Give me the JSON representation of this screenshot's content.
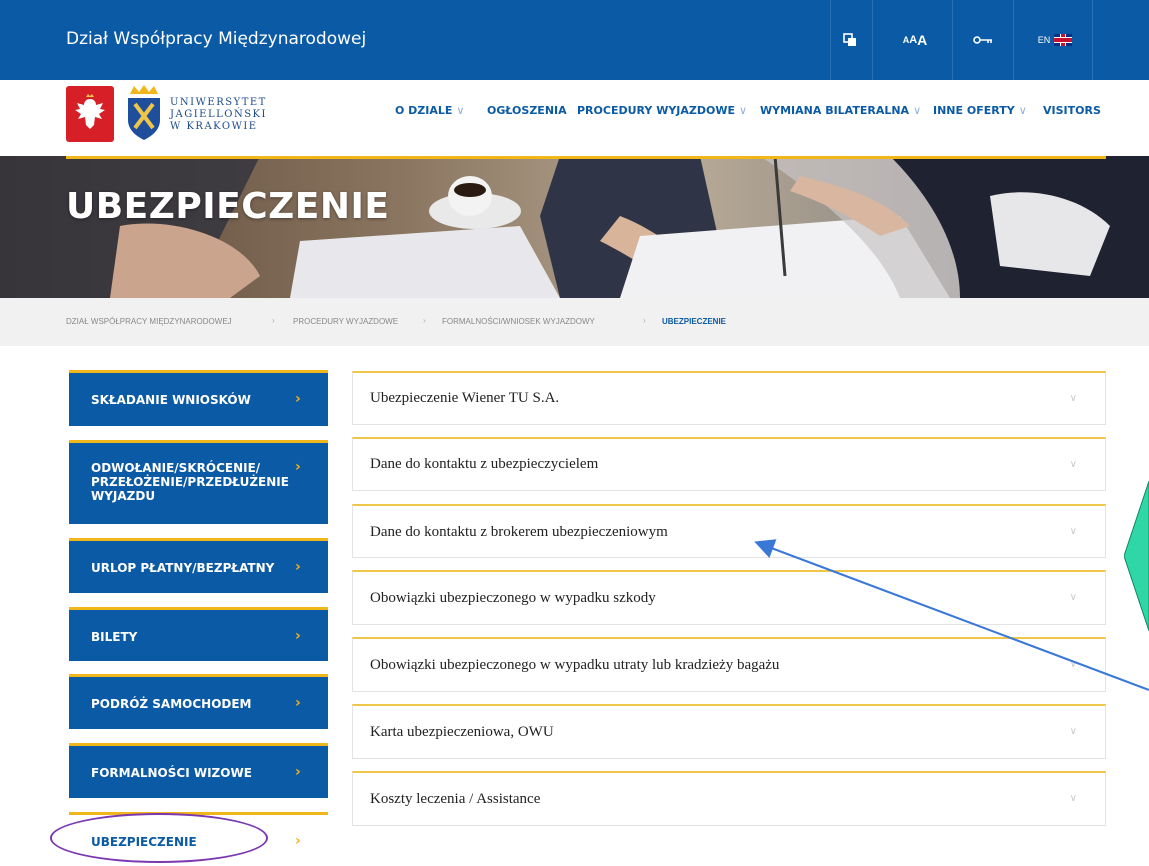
{
  "top_bar": {
    "title": "Dział Współpracy Międzynarodowej",
    "font_size_labels": [
      "A",
      "A",
      "A"
    ],
    "language": "EN"
  },
  "logo": {
    "line1": "UNIWERSYTET",
    "line2": "JAGIELLOŃSKI",
    "line3": "W KRAKOWIE"
  },
  "nav": {
    "items": [
      {
        "label": "O DZIALE",
        "has_dropdown": true
      },
      {
        "label": "OGŁOSZENIA",
        "has_dropdown": false
      },
      {
        "label": "PROCEDURY WYJAZDOWE",
        "has_dropdown": true
      },
      {
        "label": "WYMIANA BILATERALNA",
        "has_dropdown": true
      },
      {
        "label": "INNE OFERTY",
        "has_dropdown": true
      },
      {
        "label": "VISITORS",
        "has_dropdown": false
      }
    ]
  },
  "hero": {
    "title": "UBEZPIECZENIE"
  },
  "breadcrumb": {
    "items": [
      "DZIAŁ WSPÓŁPRACY MIĘDZYNARODOWEJ",
      "PROCEDURY WYJAZDOWE",
      "FORMALNOŚCI/WNIOSEK WYJAZDOWY",
      "UBEZPIECZENIE"
    ],
    "separator": "›"
  },
  "sidebar": {
    "items": [
      {
        "label": "SKŁADANIE WNIOSKÓW",
        "active": false
      },
      {
        "label": "ODWOŁANIE/SKRÓCENIE/ PRZEŁOŻENIE/PRZEDŁUŻENIE WYJAZDU",
        "active": false
      },
      {
        "label": "URLOP PŁATNY/BEZPŁATNY",
        "active": false
      },
      {
        "label": "BILETY",
        "active": false
      },
      {
        "label": "PODRÓŻ SAMOCHODEM",
        "active": false
      },
      {
        "label": "FORMALNOŚCI WIZOWE",
        "active": false
      },
      {
        "label": "UBEZPIECZENIE",
        "active": true
      }
    ],
    "arrow": "›"
  },
  "accordion": {
    "items": [
      "Ubezpieczenie Wiener TU S.A.",
      "Dane do kontaktu z ubezpieczycielem",
      "Dane do kontaktu z brokerem ubezpieczeniowym",
      "Obowiązki ubezpieczonego w wypadku szkody",
      "Obowiązki ubezpieczonego w wypadku utraty lub kradzieży bagażu",
      "Karta ubezpieczeniowa, OWU",
      "Koszty leczenia / Assistance"
    ],
    "chevron": "∨"
  },
  "colors": {
    "primary_blue": "#0b5aa5",
    "accent_gold": "#f0b61a",
    "annotation_purple": "#7b38b0",
    "annotation_arrow": "#3a78d8",
    "callout_fill": "#2fd6a6"
  }
}
